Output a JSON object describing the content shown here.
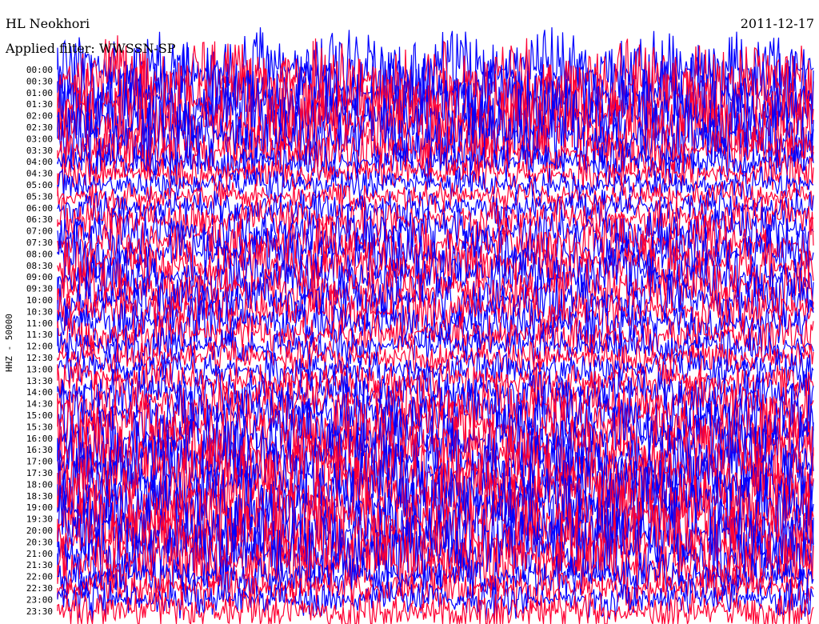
{
  "header": {
    "station": "HL Neokhori",
    "date": "2011-12-17",
    "filter": "Applied filter: WWSSN-SP"
  },
  "chart_data": {
    "type": "line",
    "chart_kind": "helicorder seismogram",
    "ylabel": "HHZ - 50000",
    "row_labels": [
      "00:00",
      "00:30",
      "01:00",
      "01:30",
      "02:00",
      "02:30",
      "03:00",
      "03:30",
      "04:00",
      "04:30",
      "05:00",
      "05:30",
      "06:00",
      "06:30",
      "07:00",
      "07:30",
      "08:00",
      "08:30",
      "09:00",
      "09:30",
      "10:00",
      "10:30",
      "11:00",
      "11:30",
      "12:00",
      "12:30",
      "13:00",
      "13:30",
      "14:00",
      "14:30",
      "15:00",
      "15:30",
      "16:00",
      "16:30",
      "17:00",
      "17:30",
      "18:00",
      "18:30",
      "19:00",
      "19:30",
      "20:00",
      "20:30",
      "21:00",
      "21:30",
      "22:00",
      "22:30",
      "23:00",
      "23:30"
    ],
    "trace_colors": [
      "#0000ff",
      "#ff0033"
    ],
    "row_activity": [
      0.85,
      0.9,
      0.95,
      1.0,
      1.0,
      1.0,
      0.9,
      0.5,
      0.35,
      0.3,
      0.25,
      0.25,
      0.3,
      0.4,
      0.5,
      0.55,
      0.6,
      0.6,
      0.55,
      0.55,
      0.55,
      0.5,
      0.45,
      0.4,
      0.35,
      0.3,
      0.3,
      0.35,
      0.5,
      0.6,
      0.7,
      0.75,
      0.8,
      0.8,
      0.85,
      0.85,
      0.9,
      0.9,
      0.95,
      0.95,
      0.95,
      0.95,
      0.9,
      0.7,
      0.4,
      0.35,
      0.35,
      0.4
    ],
    "grid": false
  }
}
